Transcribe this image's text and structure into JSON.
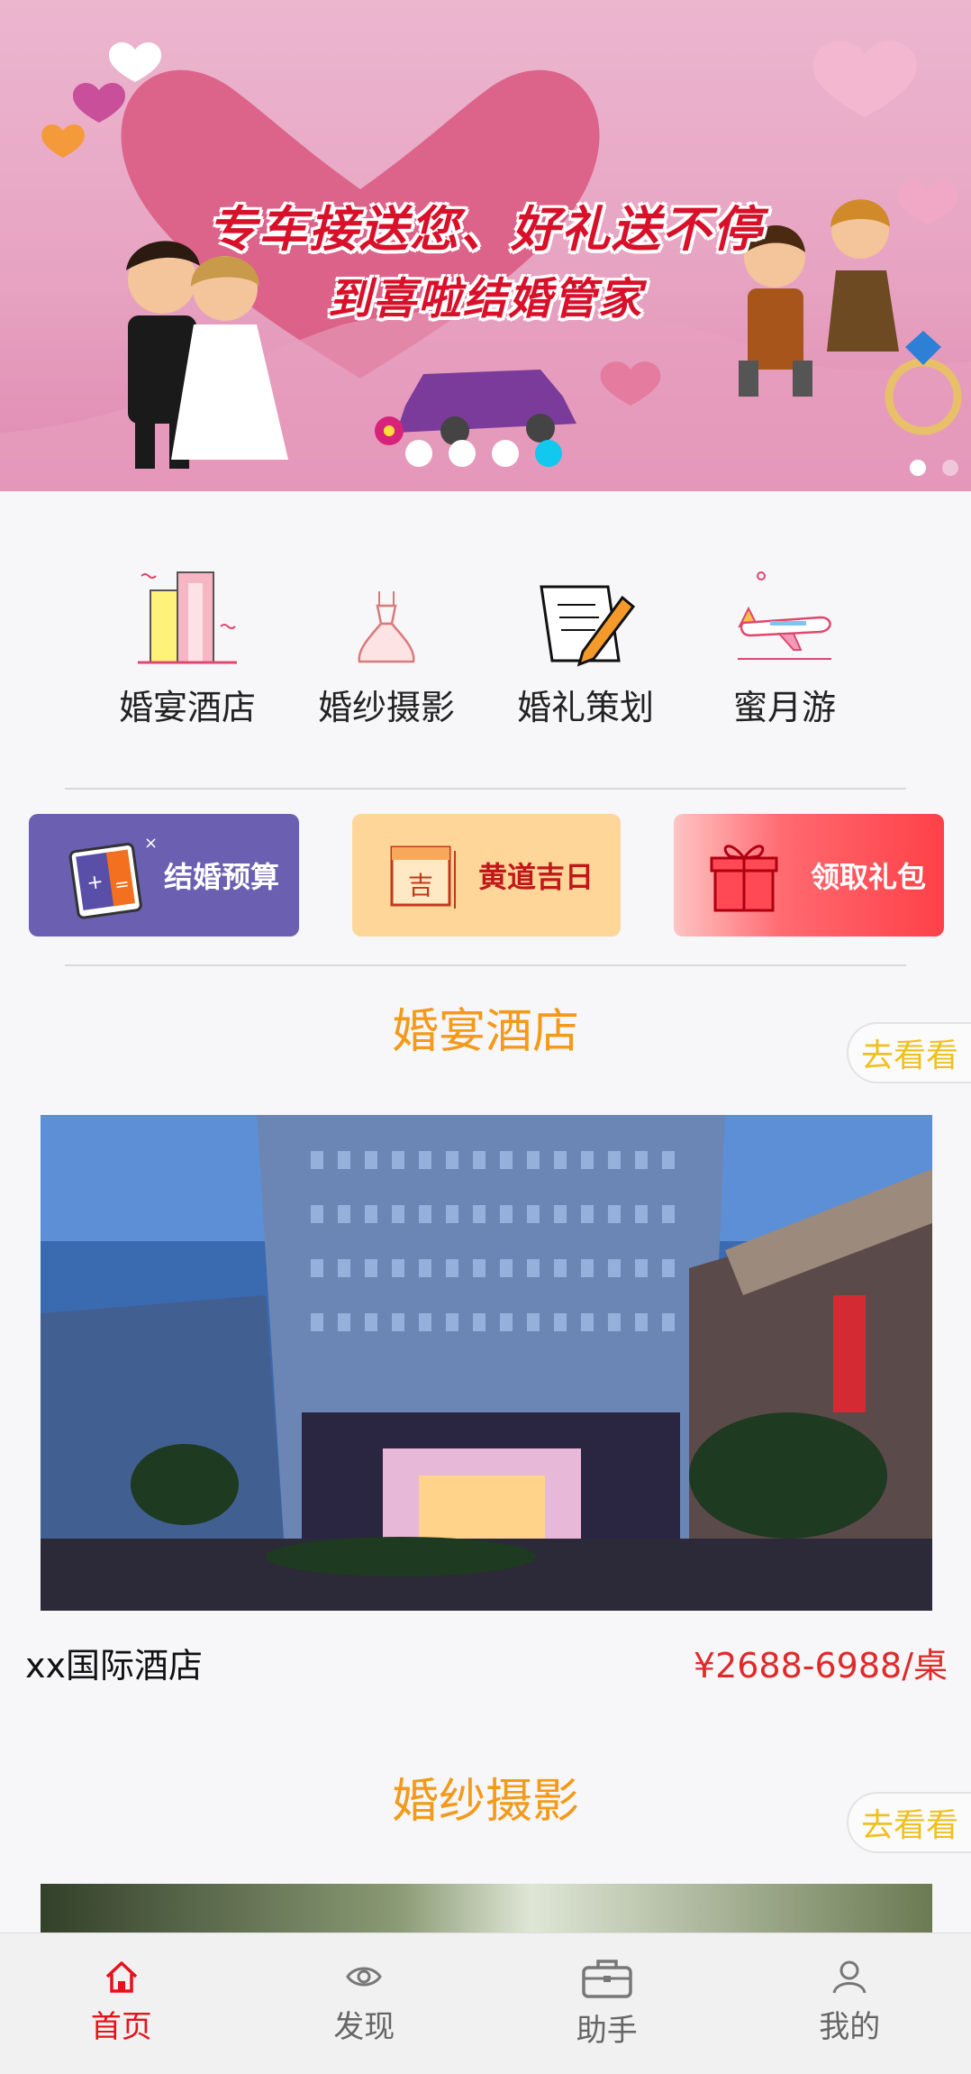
{
  "banner": {
    "line1": "专车接送您、好礼送不停",
    "line2": "到喜啦结婚管家",
    "slides": 4,
    "active_slide": 4
  },
  "categories": [
    {
      "label": "婚宴酒店",
      "icon": "hotel-building-icon"
    },
    {
      "label": "婚纱摄影",
      "icon": "wedding-dress-icon"
    },
    {
      "label": "婚礼策划",
      "icon": "planning-document-icon"
    },
    {
      "label": "蜜月游",
      "icon": "airplane-icon"
    }
  ],
  "quick_actions": [
    {
      "label": "结婚预算",
      "icon": "calculator-icon",
      "color": "#6b5fb2"
    },
    {
      "label": "黄道吉日",
      "icon": "calendar-icon",
      "color": "#ffd699"
    },
    {
      "label": "领取礼包",
      "icon": "gift-icon",
      "color": "#ff4a55"
    }
  ],
  "sections": [
    {
      "title": "婚宴酒店",
      "more": "去看看"
    },
    {
      "title": "婚纱摄影",
      "more": "去看看"
    }
  ],
  "hotel": {
    "name": "xx国际酒店",
    "price": "¥2688-6988/桌"
  },
  "tabs": [
    {
      "label": "首页",
      "icon": "home-icon",
      "active": true
    },
    {
      "label": "发现",
      "icon": "eye-icon",
      "active": false
    },
    {
      "label": "助手",
      "icon": "briefcase-icon",
      "active": false
    },
    {
      "label": "我的",
      "icon": "user-icon",
      "active": false
    }
  ],
  "colors": {
    "accent_orange": "#f39a1a",
    "price_red": "#e02a2a",
    "active_tab": "#e8101a"
  }
}
